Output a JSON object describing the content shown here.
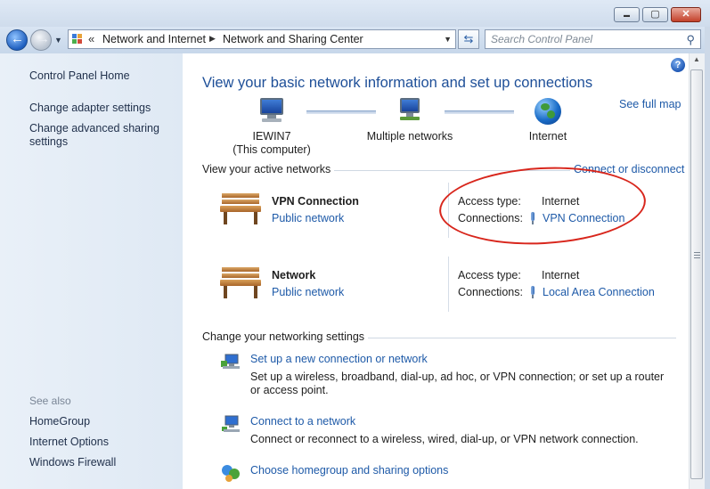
{
  "window": {
    "min_symbol": "▬",
    "max_symbol": "▢",
    "close_symbol": "✕"
  },
  "nav": {
    "back_symbol": "←",
    "forward_symbol": "→"
  },
  "address": {
    "chevron": "«",
    "crumb1": "Network and Internet",
    "separator": "▶",
    "crumb2": "Network and Sharing Center"
  },
  "search": {
    "placeholder": "Search Control Panel",
    "icon": "search-icon"
  },
  "sidebar": {
    "home": "Control Panel Home",
    "links": [
      "Change adapter settings",
      "Change advanced sharing settings"
    ],
    "see_also_label": "See also",
    "see_also": [
      "HomeGroup",
      "Internet Options",
      "Windows Firewall"
    ]
  },
  "main": {
    "title": "View your basic network information and set up connections",
    "see_full_map": "See full map",
    "map": {
      "computer_name": "IEWIN7",
      "computer_sub": "(This computer)",
      "middle": "Multiple networks",
      "internet": "Internet"
    },
    "active_networks_title": "View your active networks",
    "connect_or_disconnect": "Connect or disconnect",
    "networks": [
      {
        "name": "VPN Connection",
        "category": "Public network",
        "access_label": "Access type:",
        "access_value": "Internet",
        "connections_label": "Connections:",
        "connection": "VPN Connection"
      },
      {
        "name": "Network",
        "category": "Public network",
        "access_label": "Access type:",
        "access_value": "Internet",
        "connections_label": "Connections:",
        "connection": "Local Area Connection"
      }
    ],
    "settings_title": "Change your networking settings",
    "tasks": [
      {
        "link": "Set up a new connection or network",
        "desc": "Set up a wireless, broadband, dial-up, ad hoc, or VPN connection; or set up a router or access point."
      },
      {
        "link": "Connect to a network",
        "desc": "Connect or reconnect to a wireless, wired, dial-up, or VPN network connection."
      },
      {
        "link": "Choose homegroup and sharing options",
        "desc": ""
      }
    ]
  },
  "colors": {
    "link": "#1e5aa8",
    "title": "#1e4f98",
    "annotation_red": "#d8261c"
  }
}
